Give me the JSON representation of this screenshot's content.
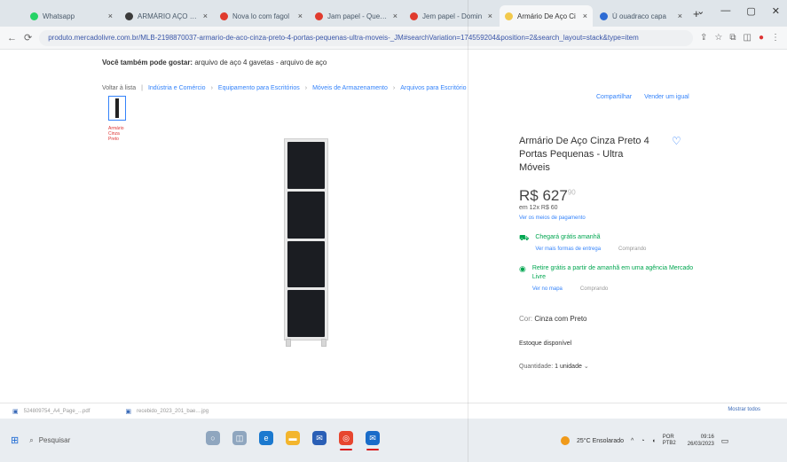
{
  "browser": {
    "tabs": [
      {
        "title": "Whatsapp",
        "color": "#25d366"
      },
      {
        "title": "ARMÁRIO AÇO VICENT",
        "color": "#3b3b3b"
      },
      {
        "title": "Nova lo com fagol",
        "color": "#e03b2e"
      },
      {
        "title": "Jam papel - Questo",
        "color": "#e03b2e"
      },
      {
        "title": "Jem papel - Domin",
        "color": "#e03b2e"
      },
      {
        "title": "Armário De Aço Ci",
        "color": "#f2c94c"
      },
      {
        "title": "Ú ouadraco capa",
        "color": "#2d6bd4"
      }
    ],
    "url": "produto.mercadolivre.com.br/MLB-2198870037-armario-de-aco-cinza-preto-4-portas-pequenas-ultra-moveis-_JM#searchVariation=174559204&position=2&search_layout=stack&type=item",
    "window_controls": [
      "⌄",
      "—",
      "▢",
      "✕"
    ]
  },
  "page": {
    "also_searched_label": "Você também pode gostar:",
    "also_searched_links": "arquivo de aço 4 gavetas - arquivo de aço",
    "breadcrumb": {
      "back": "Voltar à lista",
      "items": [
        "Indústria e Comércio",
        "Equipamento para Escritórios",
        "Móveis de Armazenamento",
        "Arquivos para Escritório"
      ]
    },
    "top_links": [
      "Compartilhar",
      "Vender um igual"
    ],
    "thumb_note": "Armário\nCinza\nPreto",
    "product": {
      "title": "Armário De Aço Cinza Preto 4 Portas Pequenas - Ultra Móveis",
      "price": "R$ 627",
      "price_cents": "90",
      "installments": "em 12x R$ 60",
      "payment_link": "Ver os meios de pagamento",
      "shipping_title": "Chegará grátis amanhã",
      "shipping_link": "Ver mais formas de entrega",
      "shipping_note": "Comprando",
      "pickup_title": "Retire grátis a partir de amanhã em uma agência Mercado Livre",
      "pickup_link": "Ver no mapa",
      "pickup_note": "Comprando",
      "color_label": "Cor:",
      "color_value": "Cinza com Preto",
      "stock": "Estoque disponível",
      "quantity_label": "Quantidade:",
      "quantity_value": "1 unidade"
    }
  },
  "downloads": {
    "items": [
      "524809754_A4_Page_...pdf",
      "recebido_2023_201_bae....jpg"
    ],
    "show_all": "Mostrar todos"
  },
  "taskbar": {
    "search_placeholder": "Pesquisar",
    "weather": "25°C Ensolarado",
    "lang": "POR PTB2",
    "time": "09:16",
    "date": "26/03/2023",
    "pinned": [
      {
        "name": "search",
        "color": "#8fa6bf"
      },
      {
        "name": "task-view",
        "color": "#8fa6bf"
      },
      {
        "name": "edge",
        "color": "#1b79cf"
      },
      {
        "name": "explorer",
        "color": "#f3b52d"
      },
      {
        "name": "mail",
        "color": "#2a5fb6"
      },
      {
        "name": "chrome",
        "color": "#e7462f"
      },
      {
        "name": "outlook",
        "color": "#1a6cc9"
      }
    ]
  }
}
